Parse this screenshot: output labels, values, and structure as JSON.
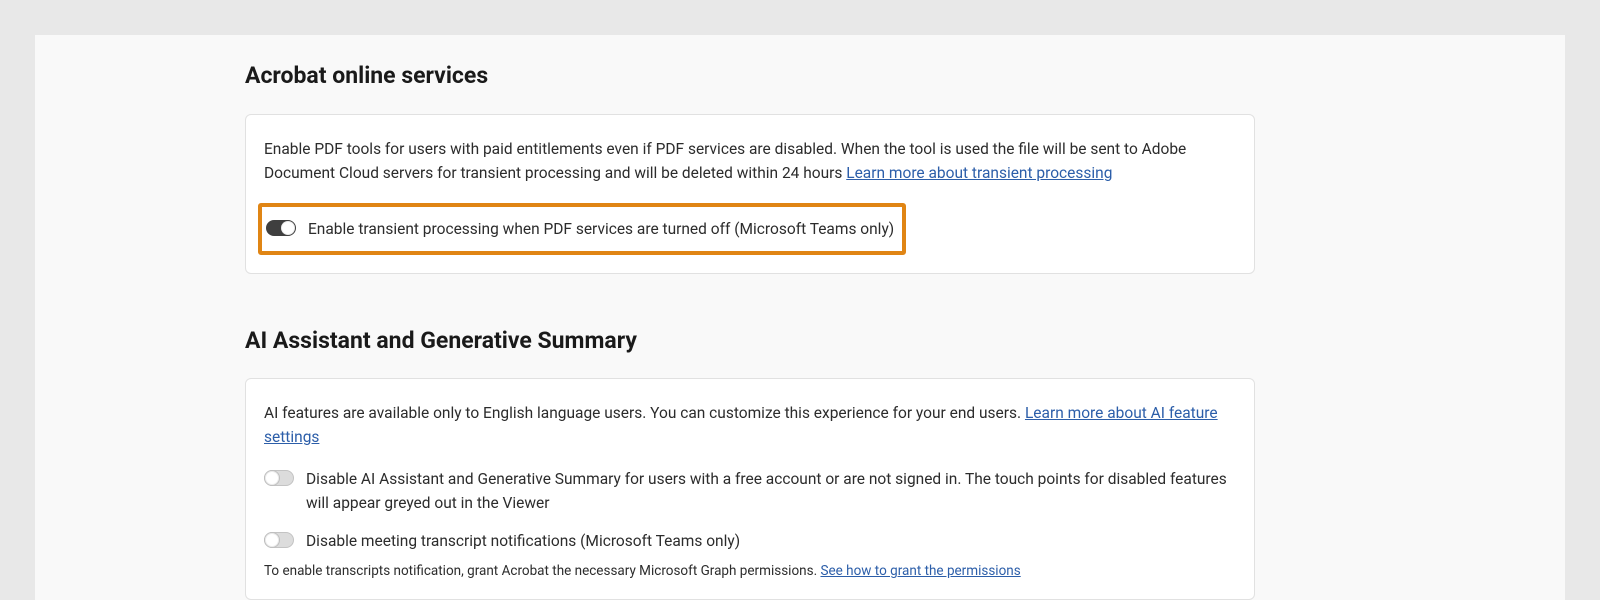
{
  "sections": {
    "acrobat": {
      "heading": "Acrobat online services",
      "description": "Enable PDF tools for users with paid entitlements even if PDF services are disabled. When the tool is used the file will be sent to Adobe Document Cloud servers for transient processing and will be deleted within 24 hours ",
      "learn_link": "Learn more about transient processing",
      "toggles": [
        {
          "label": "Enable transient processing when PDF services are turned off (Microsoft Teams only)",
          "state": "on",
          "highlighted": true
        }
      ]
    },
    "ai": {
      "heading": "AI Assistant and Generative Summary",
      "description": "AI features are available only to English language users. You can customize this experience for your end users. ",
      "learn_link": "Learn more about AI feature settings",
      "toggles": [
        {
          "label": "Disable AI Assistant and Generative Summary for users with a free account or are not signed in. The touch points for disabled features will appear greyed out in the Viewer",
          "state": "off"
        },
        {
          "label": "Disable meeting transcript notifications (Microsoft Teams only)",
          "state": "off"
        }
      ],
      "footnote": "To enable transcripts notification, grant Acrobat the necessary Microsoft Graph permissions. ",
      "footnote_link": "See how to grant the permissions"
    }
  }
}
